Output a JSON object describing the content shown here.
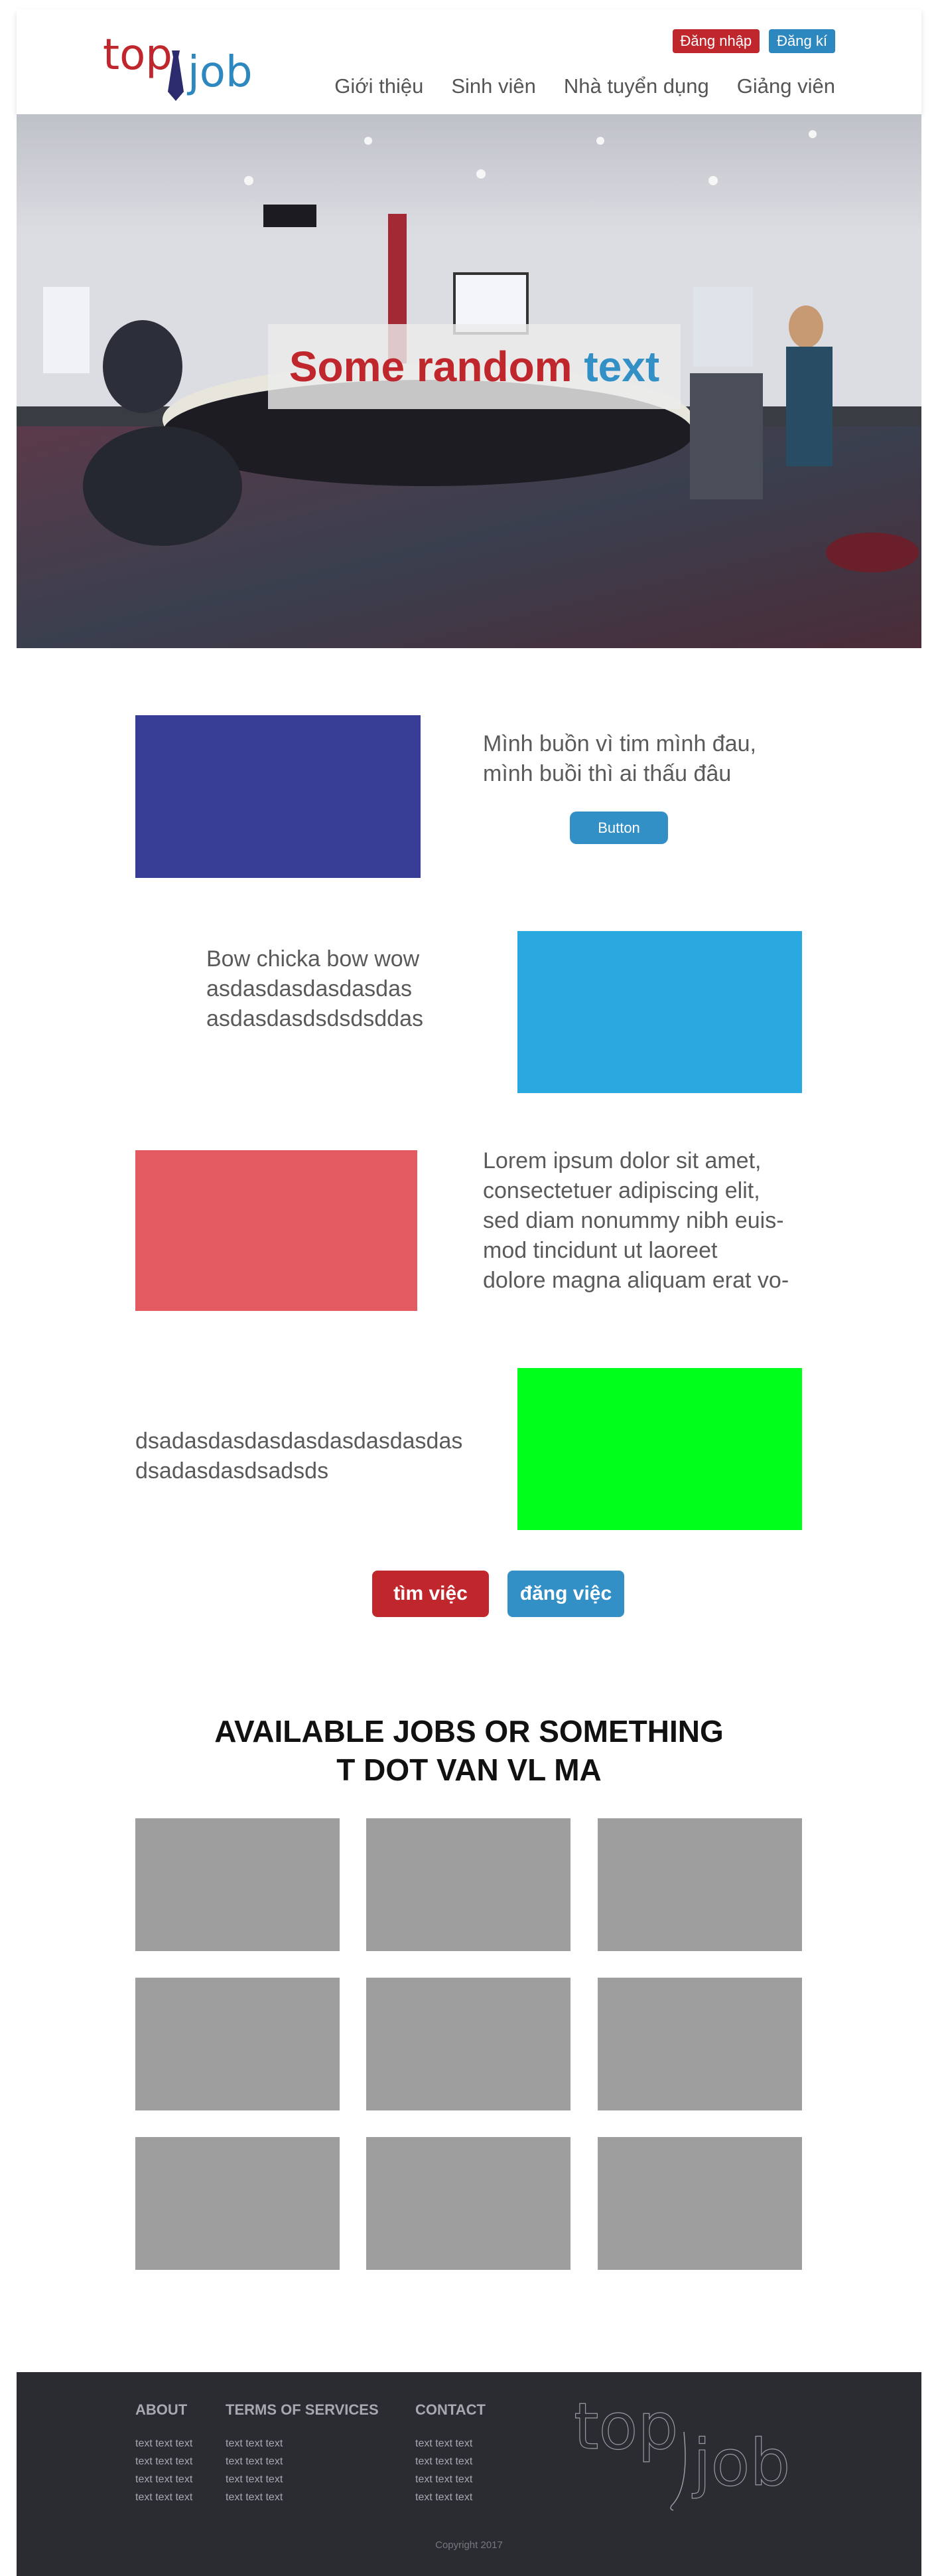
{
  "header": {
    "logo_top": "top",
    "logo_job": "job",
    "login_label": "Đăng nhập",
    "register_label": "Đăng kí",
    "nav": [
      "Giới thiệu",
      "Sinh viên",
      "Nhà tuyển dụng",
      "Giảng viên"
    ]
  },
  "hero": {
    "text_main": "Some random",
    "text_accent": "text"
  },
  "features": [
    {
      "lines": [
        "Mình buồn vì tim mình đau,",
        "mình buồi thì ai thấu đâu"
      ],
      "button": "Button",
      "color": "#373c95"
    },
    {
      "lines": [
        "Bow chicka bow wow",
        "asdasdasdasdasdas",
        "asdasdasdsdsdsddas"
      ],
      "color": "#29a9e0"
    },
    {
      "lines": [
        "Lorem ipsum dolor sit amet,",
        "consectetuer adipiscing elit,",
        "sed diam nonummy nibh euis-",
        "mod tincidunt ut laoreet",
        "dolore magna aliquam erat vo-"
      ],
      "color": "#e35a61"
    },
    {
      "lines": [
        "dsadasdasdasdasdasdasdasdas",
        "dsadasdasdsadsds"
      ],
      "color": "#00ff1a"
    }
  ],
  "cta": {
    "find_job": "tìm việc",
    "post_job": "đăng việc"
  },
  "jobs": {
    "title_line1": "AVAILABLE JOBS OR SOMETHING",
    "title_line2": "T DOT VAN VL MA"
  },
  "footer": {
    "about": {
      "heading": "ABOUT",
      "lines": [
        "text text text",
        "text text text",
        "text text text",
        "text text text"
      ]
    },
    "terms": {
      "heading": "TERMS OF SERVICES",
      "lines": [
        "text text text",
        "text text text",
        "text text text",
        "text text text"
      ]
    },
    "contact": {
      "heading": "CONTACT",
      "lines": [
        "text text text",
        "text text text",
        "text text text",
        "text text text"
      ]
    },
    "logo_top": "top",
    "logo_job": "job",
    "copyright": "Copyright 2017"
  },
  "colors": {
    "brand_red": "#c0272d",
    "brand_blue": "#2e88c0",
    "footer_bg": "#2b2b32",
    "card_gray": "#9e9e9e"
  }
}
